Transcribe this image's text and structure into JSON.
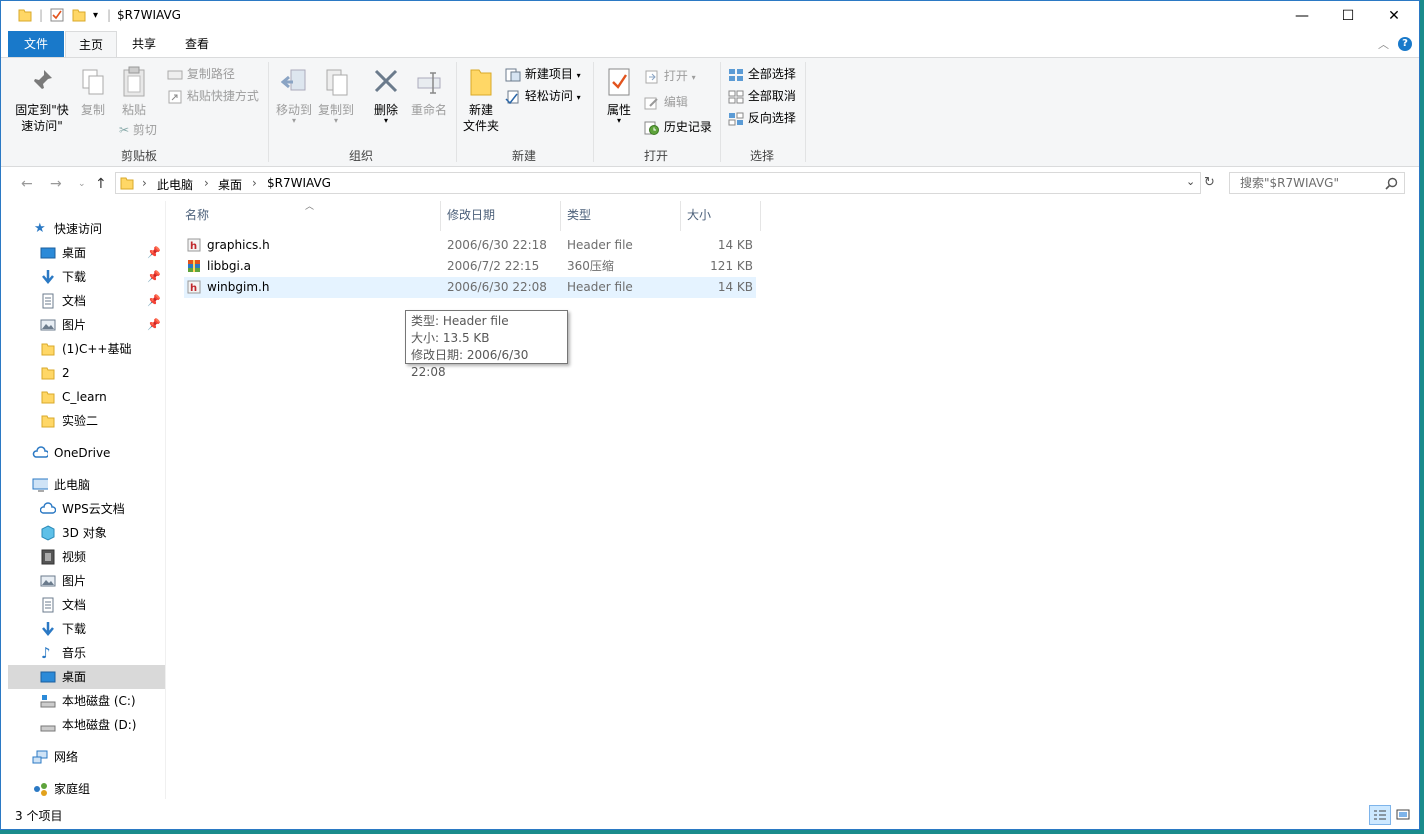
{
  "window": {
    "title": "$R7WIAVG",
    "minimize": "—",
    "maximize": "☐",
    "close": "✕"
  },
  "tabs": {
    "file": "文件",
    "home": "主页",
    "share": "共享",
    "view": "查看"
  },
  "ribbon": {
    "clipboard": {
      "label": "剪贴板",
      "pin_line1": "固定到\"快",
      "pin_line2": "速访问\"",
      "copy": "复制",
      "paste": "粘贴",
      "copy_path": "复制路径",
      "paste_shortcut": "粘贴快捷方式",
      "cut": "剪切"
    },
    "organize": {
      "label": "组织",
      "move_to": "移动到",
      "copy_to": "复制到",
      "delete": "删除",
      "rename": "重命名"
    },
    "new": {
      "label": "新建",
      "new_folder_line1": "新建",
      "new_folder_line2": "文件夹",
      "new_item": "新建项目",
      "easy_access": "轻松访问"
    },
    "open": {
      "label": "打开",
      "properties": "属性",
      "open": "打开",
      "edit": "编辑",
      "history": "历史记录"
    },
    "select": {
      "label": "选择",
      "select_all": "全部选择",
      "select_none": "全部取消",
      "invert": "反向选择"
    }
  },
  "address": {
    "crumbs": [
      "此电脑",
      "桌面",
      "$R7WIAVG"
    ],
    "search_placeholder": "搜索\"$R7WIAVG\""
  },
  "nav": {
    "quick_access": "快速访问",
    "qa_items": [
      "桌面",
      "下载",
      "文档",
      "图片",
      "(1)C++基础",
      "2",
      "C_learn",
      "实验二"
    ],
    "onedrive": "OneDrive",
    "this_pc": "此电脑",
    "pc_items": [
      "WPS云文档",
      "3D 对象",
      "视频",
      "图片",
      "文档",
      "下载",
      "音乐",
      "桌面",
      "本地磁盘 (C:)",
      "本地磁盘 (D:)"
    ],
    "network": "网络",
    "homegroup": "家庭组"
  },
  "columns": {
    "name": "名称",
    "modified": "修改日期",
    "type": "类型",
    "size": "大小"
  },
  "files": [
    {
      "name": "graphics.h",
      "modified": "2006/6/30 22:18",
      "type": "Header file",
      "size": "14 KB",
      "icon": "header-file-icon"
    },
    {
      "name": "libbgi.a",
      "modified": "2006/7/2 22:15",
      "type": "360压缩",
      "size": "121 KB",
      "icon": "archive-icon"
    },
    {
      "name": "winbgim.h",
      "modified": "2006/6/30 22:08",
      "type": "Header file",
      "size": "14 KB",
      "icon": "header-file-icon"
    }
  ],
  "tooltip": {
    "type": "类型: Header file",
    "size": "大小: 13.5 KB",
    "modified": "修改日期: 2006/6/30 22:08"
  },
  "status": {
    "count": "3 个项目"
  },
  "colors": {
    "accent": "#1979ca",
    "folder": "#ffd766",
    "hover": "#e5f3ff",
    "selected_nav": "#d9d9d9"
  }
}
